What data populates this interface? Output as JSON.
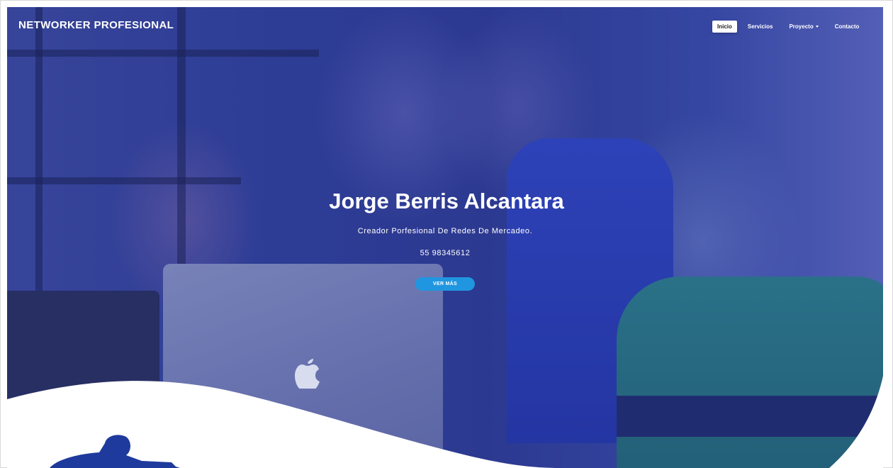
{
  "header": {
    "brand": "NETWORKER PROFESIONAL"
  },
  "nav": {
    "items": [
      {
        "label": "Inicio",
        "active": true
      },
      {
        "label": "Servicios",
        "active": false
      },
      {
        "label": "Proyecto",
        "active": false,
        "has_dropdown": true
      },
      {
        "label": "Contacto",
        "active": false
      }
    ]
  },
  "hero": {
    "title": "Jorge Berris Alcantara",
    "subtitle": "Creador Porfesional De Redes De Mercadeo.",
    "phone": "55 98345612",
    "cta_label": "VER MÁS"
  },
  "colors": {
    "overlay": "#2f3f96",
    "cta": "#2196e0",
    "brand_text": "#ffffff"
  }
}
